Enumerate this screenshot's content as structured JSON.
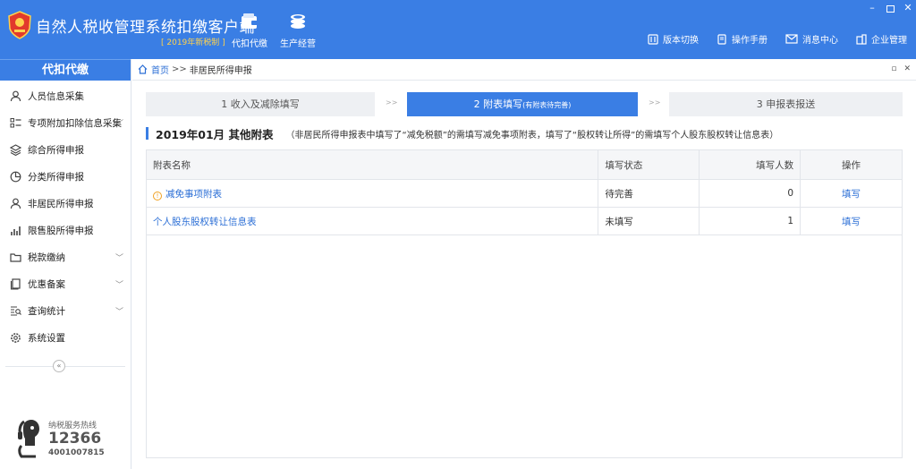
{
  "header": {
    "title": "自然人税收管理系统扣缴客户端",
    "badge": "[ 2019年新税制 ]",
    "nav": [
      {
        "label": "代扣代缴",
        "icon": "wallet-icon"
      },
      {
        "label": "生产经营",
        "icon": "coins-icon"
      }
    ],
    "links": [
      {
        "label": "版本切换",
        "icon": "switch-icon"
      },
      {
        "label": "操作手册",
        "icon": "book-icon"
      },
      {
        "label": "消息中心",
        "icon": "mail-icon"
      },
      {
        "label": "企业管理",
        "icon": "building-icon"
      }
    ],
    "window_controls": {
      "min": "–",
      "close": "✕"
    }
  },
  "sidebar": {
    "header": "代扣代缴",
    "items": [
      {
        "label": "人员信息采集",
        "icon": "person-icon",
        "has_submenu": false
      },
      {
        "label": "专项附加扣除信息采集",
        "icon": "list-icon",
        "has_submenu": true
      },
      {
        "label": "综合所得申报",
        "icon": "layers-icon",
        "has_submenu": false
      },
      {
        "label": "分类所得申报",
        "icon": "pie-icon",
        "has_submenu": false
      },
      {
        "label": "非居民所得申报",
        "icon": "person-icon",
        "has_submenu": false
      },
      {
        "label": "限售股所得申报",
        "icon": "bar-chart-icon",
        "has_submenu": false
      },
      {
        "label": "税款缴纳",
        "icon": "folder-icon",
        "has_submenu": true
      },
      {
        "label": "优惠备案",
        "icon": "document-icon",
        "has_submenu": true
      },
      {
        "label": "查询统计",
        "icon": "search-list-icon",
        "has_submenu": true
      },
      {
        "label": "系统设置",
        "icon": "gear-icon",
        "has_submenu": false
      }
    ],
    "collapse_glyph": "«",
    "hotline": {
      "label": "纳税服务热线",
      "number": "12366",
      "number2": "4001007815"
    }
  },
  "breadcrumb": {
    "home": "首页",
    "separator": ">>",
    "current": "非居民所得申报"
  },
  "steps": [
    {
      "label": "1 收入及减除填写",
      "sub": ""
    },
    {
      "label": "2 附表填写",
      "sub": "(有附表待完善)"
    },
    {
      "label": "3 申报表报送",
      "sub": ""
    }
  ],
  "step_arrow": ">>",
  "section": {
    "title": "2019年01月  其他附表",
    "note": "（非居民所得申报表中填写了“减免税额”的需填写减免事项附表，填写了“股权转让所得”的需填写个人股东股权转让信息表）"
  },
  "table": {
    "columns": [
      "附表名称",
      "填写状态",
      "填写人数",
      "操作"
    ],
    "rows": [
      {
        "name": "减免事项附表",
        "warning": true,
        "status": "待完善",
        "count": "0",
        "action": "填写"
      },
      {
        "name": "个人股东股权转让信息表",
        "warning": false,
        "status": "未填写",
        "count": "1",
        "action": "填写"
      }
    ]
  },
  "colors": {
    "primary": "#3a7ee4",
    "link": "#2c6fd6",
    "warning": "#f0a020",
    "badge": "#ffd24d"
  }
}
